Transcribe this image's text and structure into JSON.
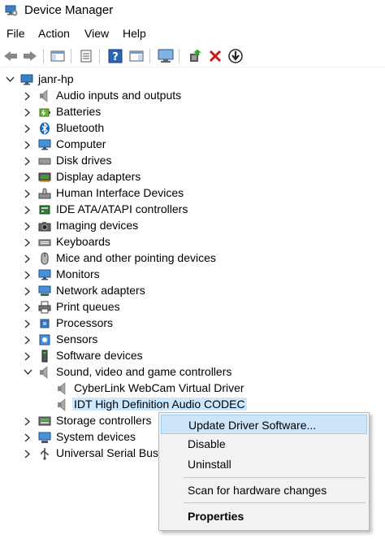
{
  "window": {
    "title": "Device Manager"
  },
  "menu": [
    "File",
    "Action",
    "View",
    "Help"
  ],
  "toolbar": {
    "buttons": [
      "back-icon",
      "forward-icon",
      "show-hide-console-tree-icon",
      "properties-icon",
      "help-icon",
      "action-pane-icon",
      "monitor-icon",
      "update-driver-icon",
      "uninstall-icon",
      "scan-hardware-icon"
    ]
  },
  "tree": {
    "root": "janr-hp",
    "categories": [
      {
        "label": "Audio inputs and outputs",
        "icon": "speaker-icon"
      },
      {
        "label": "Batteries",
        "icon": "battery-icon"
      },
      {
        "label": "Bluetooth",
        "icon": "bluetooth-icon"
      },
      {
        "label": "Computer",
        "icon": "computer-icon"
      },
      {
        "label": "Disk drives",
        "icon": "disk-drive-icon"
      },
      {
        "label": "Display adapters",
        "icon": "display-adapter-icon"
      },
      {
        "label": "Human Interface Devices",
        "icon": "hid-icon"
      },
      {
        "label": "IDE ATA/ATAPI controllers",
        "icon": "ide-controller-icon"
      },
      {
        "label": "Imaging devices",
        "icon": "camera-icon"
      },
      {
        "label": "Keyboards",
        "icon": "keyboard-icon"
      },
      {
        "label": "Mice and other pointing devices",
        "icon": "mouse-icon"
      },
      {
        "label": "Monitors",
        "icon": "monitor-icon"
      },
      {
        "label": "Network adapters",
        "icon": "network-adapter-icon"
      },
      {
        "label": "Print queues",
        "icon": "printer-icon"
      },
      {
        "label": "Processors",
        "icon": "processor-icon"
      },
      {
        "label": "Sensors",
        "icon": "sensor-icon"
      },
      {
        "label": "Software devices",
        "icon": "software-device-icon"
      },
      {
        "label": "Sound, video and game controllers",
        "icon": "speaker-icon",
        "expanded": true,
        "children": [
          {
            "label": "CyberLink WebCam Virtual Driver",
            "icon": "speaker-icon"
          },
          {
            "label": "IDT High Definition Audio CODEC",
            "icon": "speaker-icon",
            "selected": true
          }
        ]
      },
      {
        "label": "Storage controllers",
        "icon": "storage-controller-icon"
      },
      {
        "label": "System devices",
        "icon": "system-device-icon"
      },
      {
        "label": "Universal Serial Bus co",
        "icon": "usb-icon"
      }
    ]
  },
  "context_menu": {
    "items": [
      {
        "label": "Update Driver Software...",
        "highlighted": true
      },
      {
        "label": "Disable"
      },
      {
        "label": "Uninstall"
      },
      {
        "label": "Scan for hardware changes"
      },
      {
        "label": "Properties",
        "bold": true
      }
    ]
  }
}
